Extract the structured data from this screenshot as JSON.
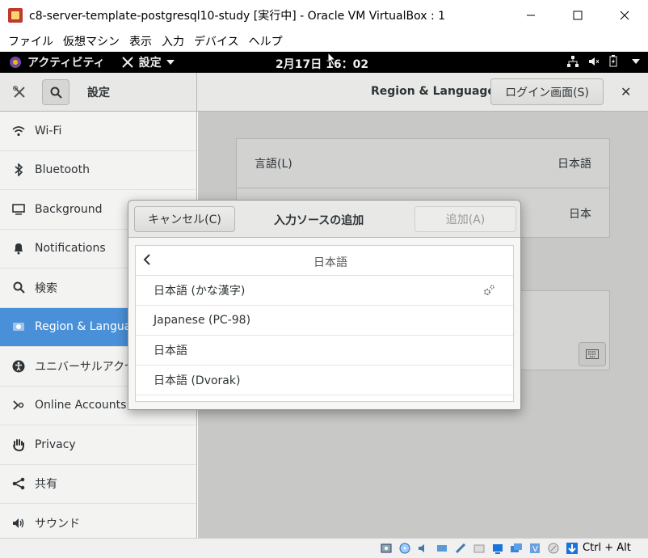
{
  "window": {
    "title": "c8-server-template-postgresql10-study [実行中] - Oracle VM VirtualBox : 1",
    "minimize": "─",
    "maximize": "☐",
    "close": "✕"
  },
  "menubar": [
    "ファイル",
    "仮想マシン",
    "表示",
    "入力",
    "デバイス",
    "ヘルプ"
  ],
  "topbar": {
    "activities": "アクティビティ",
    "app_menu": "設定",
    "clock": "2月17日  16：02"
  },
  "header": {
    "sidebar_title": "設定",
    "panel_title": "Region & Language",
    "login_button": "ログイン画面(S)",
    "close": "✕"
  },
  "sidebar": {
    "items": [
      {
        "label": "Wi-Fi",
        "icon": "wifi-icon"
      },
      {
        "label": "Bluetooth",
        "icon": "bluetooth-icon"
      },
      {
        "label": "Background",
        "icon": "display-icon"
      },
      {
        "label": "Notifications",
        "icon": "bell-icon"
      },
      {
        "label": "検索",
        "icon": "search-icon"
      },
      {
        "label": "Region & Language",
        "icon": "flag-icon",
        "selected": true
      },
      {
        "label": "ユニバーサルアクセス",
        "icon": "accessibility-icon"
      },
      {
        "label": "Online Accounts",
        "icon": "online-accounts-icon"
      },
      {
        "label": "Privacy",
        "icon": "hand-icon"
      },
      {
        "label": "共有",
        "icon": "share-icon"
      },
      {
        "label": "サウンド",
        "icon": "speaker-icon"
      }
    ]
  },
  "main": {
    "rows": [
      {
        "label": "言語(L)",
        "value": "日本語"
      },
      {
        "label": "",
        "value": "日本"
      }
    ]
  },
  "dialog": {
    "cancel": "キャンセル(C)",
    "title": "入力ソースの追加",
    "add": "追加(A)",
    "current_language": "日本語",
    "items": [
      {
        "label": "日本語 (かな漢字)",
        "has_settings": true
      },
      {
        "label": "Japanese (PC-98)"
      },
      {
        "label": "日本語"
      },
      {
        "label": "日本語 (Dvorak)"
      }
    ]
  },
  "statusbar": {
    "hostkey": "Ctrl + Alt"
  }
}
